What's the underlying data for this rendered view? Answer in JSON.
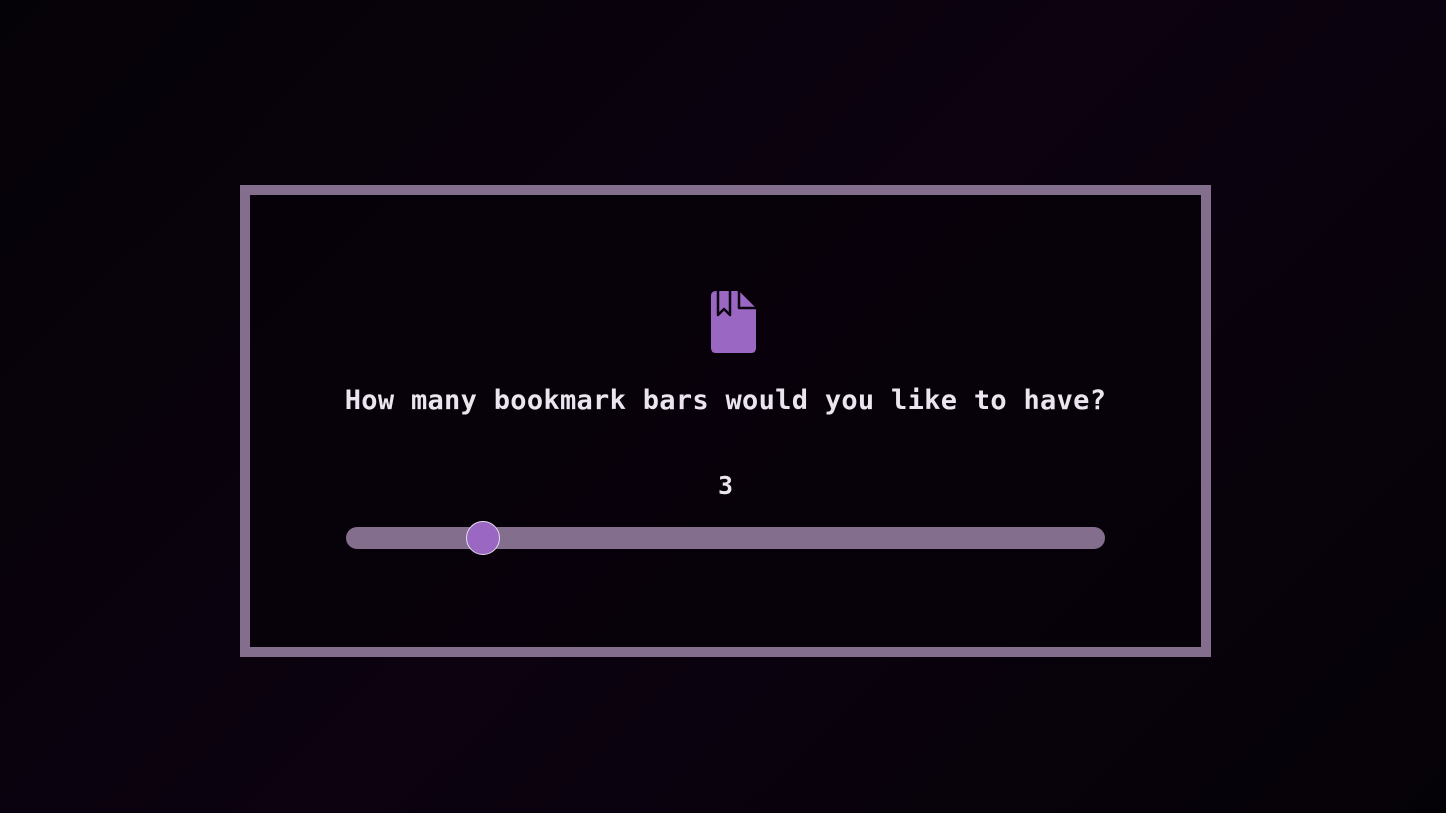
{
  "dialog": {
    "icon": "bookmark-file-icon",
    "question": "How many bookmark bars would you like to have?",
    "value": "3",
    "slider": {
      "value": 3,
      "min": 0,
      "max": 17,
      "fraction": 0.18
    }
  },
  "colors": {
    "background": "#07030a",
    "border": "#836e8d",
    "accent": "#9a67c3",
    "text": "#eae5ee"
  }
}
